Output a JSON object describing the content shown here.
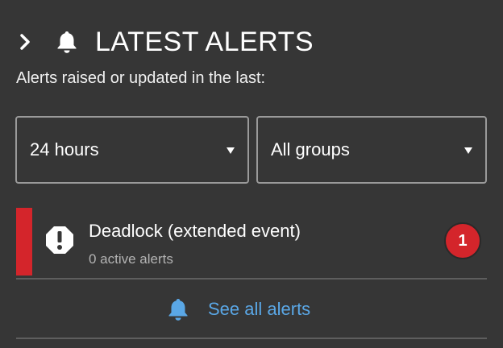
{
  "panel": {
    "title": "LATEST ALERTS",
    "subtitle": "Alerts raised or updated in the last:",
    "icons": {
      "toggle": "chevron-right-icon",
      "header": "bell-icon"
    }
  },
  "filters": {
    "time_range": {
      "selected": "24 hours"
    },
    "group": {
      "selected": "All groups"
    }
  },
  "alerts": [
    {
      "name": "Deadlock (extended event)",
      "status": "0 active alerts",
      "count": "1",
      "severity_color": "#d4252b",
      "icon": "exclamation-octagon-icon"
    }
  ],
  "footer": {
    "see_all_label": "See all alerts",
    "icon": "bell-icon",
    "link_color": "#5aa7e6"
  }
}
